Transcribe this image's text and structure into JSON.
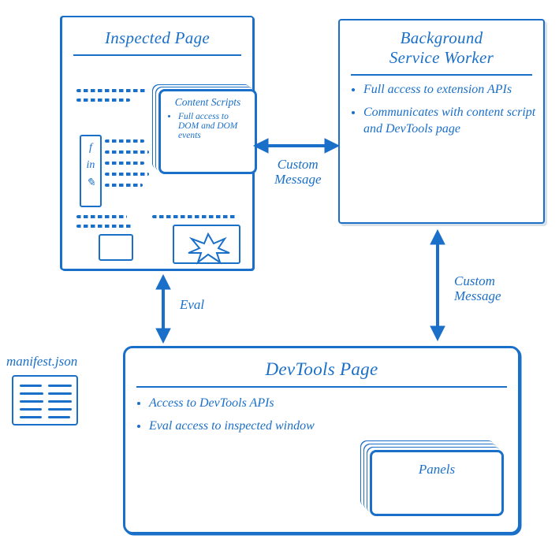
{
  "inspected": {
    "title": "Inspected Page",
    "content_scripts": {
      "title": "Content Scripts",
      "bullet1": "Full access to DOM and DOM events"
    },
    "social": {
      "f": "f",
      "in": "in",
      "bird": "✎"
    }
  },
  "bgworker": {
    "title_line1": "Background",
    "title_line2": "Service Worker",
    "bullet1": "Full access to extension APIs",
    "bullet2": "Communicates with content script and DevTools page"
  },
  "devtools": {
    "title": "DevTools Page",
    "bullet1": "Access to DevTools APIs",
    "bullet2": "Eval access to inspected window",
    "panels": {
      "title": "Panels"
    }
  },
  "manifest": {
    "label": "manifest.json"
  },
  "arrows": {
    "custom_message_top": "Custom\nMessage",
    "eval": "Eval",
    "custom_message_right": "Custom\nMessage"
  }
}
